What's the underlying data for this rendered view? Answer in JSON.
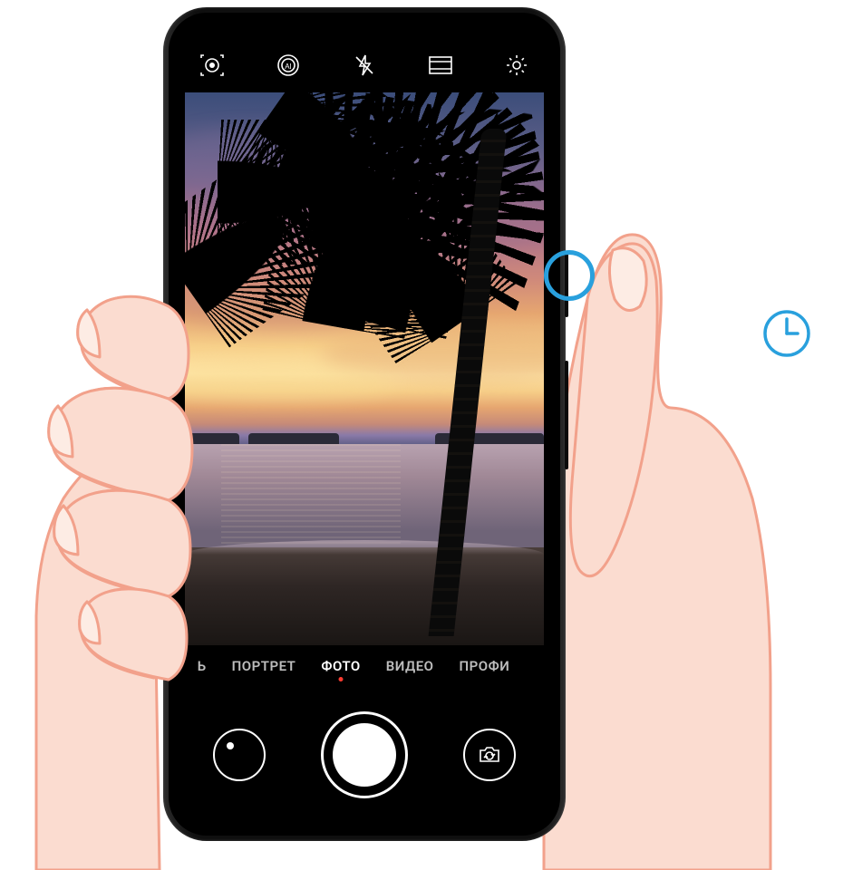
{
  "colors": {
    "accent": "#29a0dd",
    "hand_fill": "#fbdcd0",
    "hand_stroke": "#f2a18b",
    "mode_indicator": "#ff3b30"
  },
  "topbar": {
    "icons": [
      {
        "name": "lens-mode-icon"
      },
      {
        "name": "ai-mode-icon"
      },
      {
        "name": "flash-off-icon"
      },
      {
        "name": "aspect-ratio-icon"
      },
      {
        "name": "settings-gear-icon"
      }
    ]
  },
  "modes": {
    "items": [
      {
        "label": "Ь",
        "partial": true
      },
      {
        "label": "ПОРТРЕТ"
      },
      {
        "label": "ФОТО",
        "active": true
      },
      {
        "label": "ВИДЕО"
      },
      {
        "label": "ПРОФИ"
      }
    ],
    "active_index": 2
  },
  "controls": {
    "gallery_name": "gallery-thumbnail",
    "shutter_name": "shutter-button",
    "switch_name": "switch-camera-button"
  },
  "hints": {
    "press_ring_name": "power-button-press-indicator",
    "clock_name": "long-press-timer-icon"
  },
  "viewfinder": {
    "description": "beach-sunset-palm-tree"
  }
}
